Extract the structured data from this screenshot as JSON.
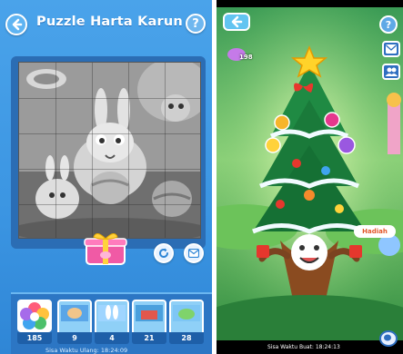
{
  "left_panel": {
    "title": "Puzzle Harta Karun",
    "help_label": "?",
    "footer_text": "Sisa Waktu Ulang: 18:24:09",
    "tray": {
      "first_count": "185",
      "slots": [
        {
          "count": "9"
        },
        {
          "count": "4"
        },
        {
          "count": "21"
        },
        {
          "count": "28"
        }
      ]
    }
  },
  "right_panel": {
    "coin_count": "198",
    "help_label": "?",
    "reward_label": "Hadiah",
    "footer_text": "Sisa Waktu Buat: 18:24:13"
  },
  "icons": {
    "back": "back-arrow-icon",
    "help": "help-icon",
    "refresh": "refresh-icon",
    "mail": "mail-icon",
    "gift": "gift-box-icon",
    "friends": "friends-icon",
    "chat": "chat-icon"
  },
  "colors": {
    "left_bg": "#3b95e2",
    "tray_bg": "#2c76c4",
    "board_tint": "#9a9a9a",
    "gift_pink": "#f05aa5",
    "hadiah_text": "#e2572b",
    "tree_green": "#1f8a43"
  }
}
